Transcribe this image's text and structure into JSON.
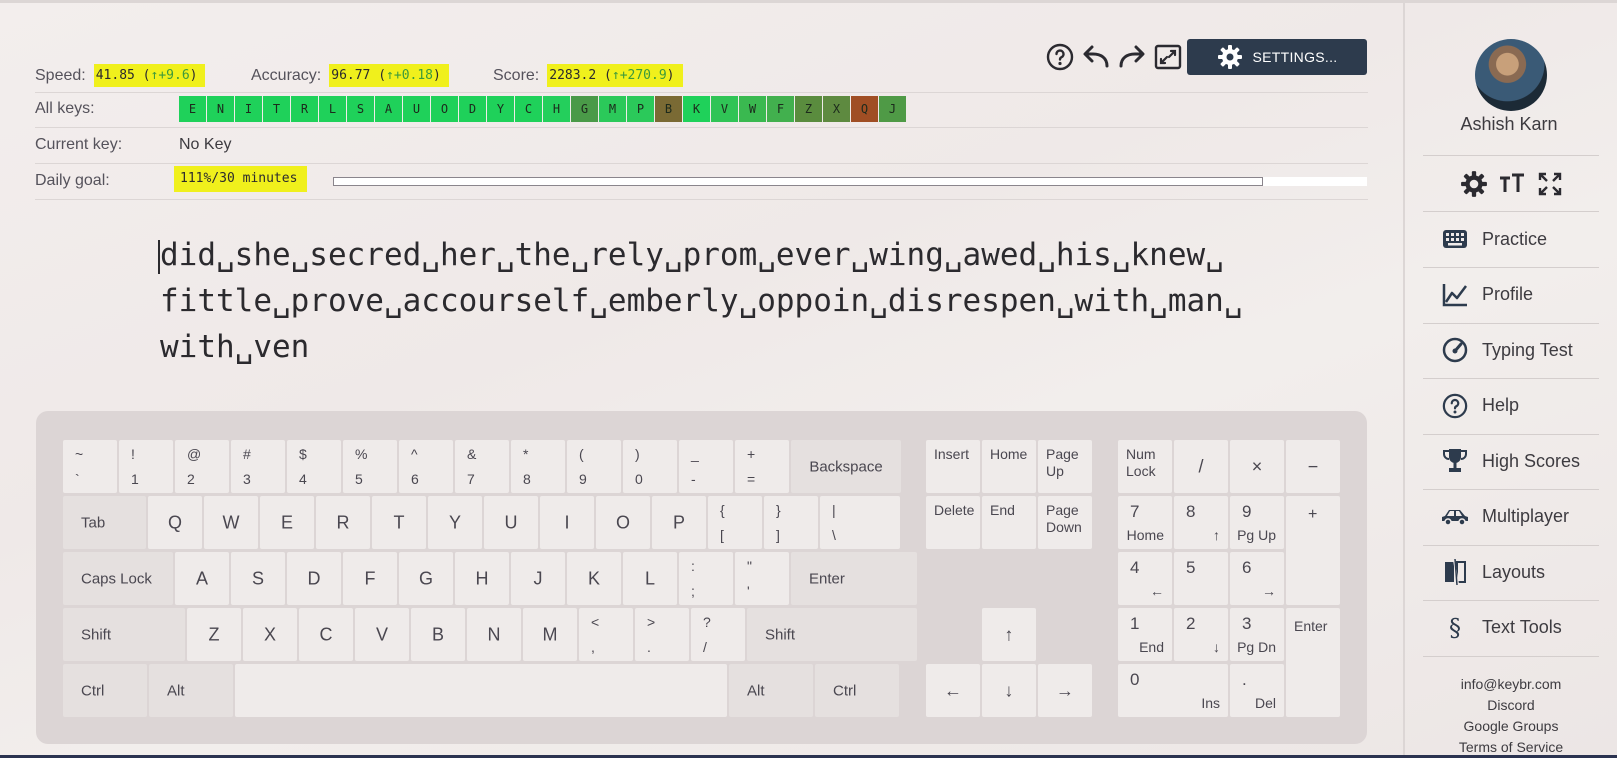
{
  "stats": {
    "speed": {
      "label": "Speed:",
      "value": "41.85",
      "delta": "↑+9.6"
    },
    "accuracy": {
      "label": "Accuracy:",
      "value": "96.77",
      "delta": "↑+0.18"
    },
    "score": {
      "label": "Score:",
      "value": "2283.2",
      "delta": "↑+270.9"
    }
  },
  "rows": {
    "all_keys_label": "All keys:",
    "current_key_label": "Current key:",
    "current_key_value": "No Key",
    "daily_goal_label": "Daily goal:",
    "daily_goal_value": "111%/30 minutes",
    "daily_goal_progress": 1.0
  },
  "keys": [
    {
      "ch": "E",
      "color": "#1fd15a"
    },
    {
      "ch": "N",
      "color": "#1fd15a"
    },
    {
      "ch": "I",
      "color": "#1fd15a"
    },
    {
      "ch": "T",
      "color": "#1fd15a"
    },
    {
      "ch": "R",
      "color": "#1fd15a"
    },
    {
      "ch": "L",
      "color": "#1fd15a"
    },
    {
      "ch": "S",
      "color": "#1fd15a"
    },
    {
      "ch": "A",
      "color": "#1fd15a"
    },
    {
      "ch": "U",
      "color": "#1fd15a"
    },
    {
      "ch": "O",
      "color": "#1fd15a"
    },
    {
      "ch": "D",
      "color": "#1fd15a"
    },
    {
      "ch": "Y",
      "color": "#1fd15a"
    },
    {
      "ch": "C",
      "color": "#1fd15a"
    },
    {
      "ch": "H",
      "color": "#24cf5c"
    },
    {
      "ch": "G",
      "color": "#4a9a48"
    },
    {
      "ch": "M",
      "color": "#2bc95a"
    },
    {
      "ch": "P",
      "color": "#2bc95a"
    },
    {
      "ch": "B",
      "color": "#7a6a34"
    },
    {
      "ch": "K",
      "color": "#1fd15a"
    },
    {
      "ch": "V",
      "color": "#30c456"
    },
    {
      "ch": "W",
      "color": "#3ab950"
    },
    {
      "ch": "F",
      "color": "#42b04e"
    },
    {
      "ch": "Z",
      "color": "#5a8c3e"
    },
    {
      "ch": "X",
      "color": "#5e8a40"
    },
    {
      "ch": "Q",
      "color": "#a04e24"
    },
    {
      "ch": "J",
      "color": "#4f9a46"
    }
  ],
  "toolbar": {
    "help_icon": "help-circle-icon",
    "undo_icon": "undo-icon",
    "redo_icon": "redo-icon",
    "fullscreen_icon": "fullscreen-icon",
    "settings_label": "SETTINGS...",
    "settings_color": "#2d3b4d"
  },
  "lesson": {
    "line1": "did␣she␣secred␣her␣the␣rely␣prom␣ever␣wing␣awed␣his␣knew␣",
    "line2": "fittle␣prove␣accourself␣emberly␣oppoin␣disrespen␣with␣man␣",
    "line3": "with␣ven"
  },
  "keyboard": {
    "row1": [
      [
        "~",
        "`"
      ],
      [
        "!",
        "1"
      ],
      [
        "@",
        "2"
      ],
      [
        "#",
        "3"
      ],
      [
        "$",
        "4"
      ],
      [
        "%",
        "5"
      ],
      [
        "^",
        "6"
      ],
      [
        "&",
        "7"
      ],
      [
        "*",
        "8"
      ],
      [
        "(",
        "9"
      ],
      [
        ")",
        "0"
      ],
      [
        "_",
        "-"
      ],
      [
        "+",
        "="
      ]
    ],
    "backspace": "Backspace",
    "tab": "Tab",
    "row2": [
      "Q",
      "W",
      "E",
      "R",
      "T",
      "Y",
      "U",
      "I",
      "O",
      "P"
    ],
    "row2_sym": [
      [
        "{",
        "["
      ],
      [
        "}",
        "]"
      ],
      [
        "|",
        "\\"
      ]
    ],
    "caps": "Caps Lock",
    "row3": [
      "A",
      "S",
      "D",
      "F",
      "G",
      "H",
      "J",
      "K",
      "L"
    ],
    "row3_sym": [
      [
        ":",
        ";"
      ],
      [
        "\"",
        "'"
      ]
    ],
    "enter": "Enter",
    "shift": "Shift",
    "row4": [
      "Z",
      "X",
      "C",
      "V",
      "B",
      "N",
      "M"
    ],
    "row4_sym": [
      [
        "<",
        ","
      ],
      [
        ">",
        "."
      ],
      [
        "?",
        "/"
      ]
    ],
    "ctrl": "Ctrl",
    "alt": "Alt",
    "nav": {
      "insert": "Insert",
      "home": "Home",
      "page_up": "Page\nUp",
      "delete": "Delete",
      "end": "End",
      "page_down": "Page\nDown"
    },
    "arrows": {
      "up": "↑",
      "left": "←",
      "down": "↓",
      "right": "→"
    },
    "numpad": {
      "num_lock": "Num\nLock",
      "slash": "/",
      "times": "×",
      "minus": "−",
      "plus": "+",
      "enter": "Enter",
      "n7": [
        "7",
        "Home"
      ],
      "n8": [
        "8",
        "↑"
      ],
      "n9": [
        "9",
        "Pg Up"
      ],
      "n4": [
        "4",
        "←"
      ],
      "n5": [
        "5",
        ""
      ],
      "n6": [
        "6",
        "→"
      ],
      "n1": [
        "1",
        "End"
      ],
      "n2": [
        "2",
        "↓"
      ],
      "n3": [
        "3",
        "Pg Dn"
      ],
      "n0": [
        "0",
        "Ins"
      ],
      "dot": [
        ".",
        "Del"
      ]
    }
  },
  "sidebar": {
    "username": "Ashish Karn",
    "tools": [
      "gear-icon",
      "font-size-icon",
      "expand-icon"
    ],
    "nav": [
      {
        "label": "Practice",
        "icon": "keyboard-icon"
      },
      {
        "label": "Profile",
        "icon": "chart-icon"
      },
      {
        "label": "Typing Test",
        "icon": "speedometer-icon"
      },
      {
        "label": "Help",
        "icon": "help-icon"
      },
      {
        "label": "High Scores",
        "icon": "trophy-icon"
      },
      {
        "label": "Multiplayer",
        "icon": "car-icon"
      },
      {
        "label": "Layouts",
        "icon": "layouts-icon"
      },
      {
        "label": "Text Tools",
        "icon": "section-icon"
      }
    ],
    "links": [
      "info@keybr.com",
      "Discord",
      "Google Groups",
      "Terms of Service"
    ]
  }
}
